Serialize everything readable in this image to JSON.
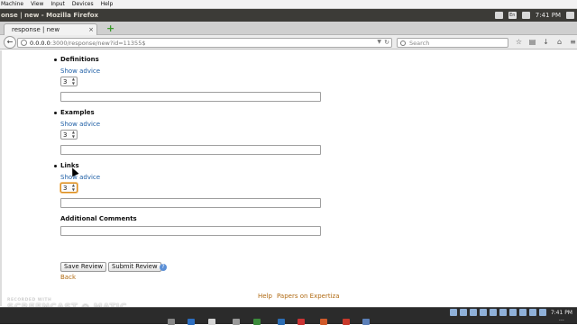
{
  "vm_menu": [
    "Machine",
    "View",
    "Input",
    "Devices",
    "Help"
  ],
  "window_title": "onse | new - Mozilla Firefox",
  "panel_clock": "7:41 PM",
  "panel_lang": "En",
  "tab": {
    "label": "response | new",
    "close": "×"
  },
  "new_tab_symbol": "+",
  "nav": {
    "back_symbol": "←",
    "url_host": "0.0.0.0",
    "url_path": ":3000/response/new?id=11355$",
    "search_placeholder": "Search"
  },
  "sections": [
    {
      "title": "Definitions",
      "advice": "Show advice",
      "score": "3"
    },
    {
      "title": "Examples",
      "advice": "Show advice",
      "score": "3"
    },
    {
      "title": "Links",
      "advice": "Show advice",
      "score": "3"
    }
  ],
  "comments_label": "Additional Comments",
  "buttons": {
    "save": "Save Review",
    "submit": "Submit Review",
    "help_q": "?"
  },
  "back_link": "Back",
  "footer": {
    "help": "Help",
    "papers": "Papers on Expertiza"
  },
  "watermark": {
    "top": "RECORDED WITH",
    "brand": "SCREENCAST ◉ MATIC"
  },
  "taskbar_clock": [
    "7:41 PM",
    "…"
  ]
}
